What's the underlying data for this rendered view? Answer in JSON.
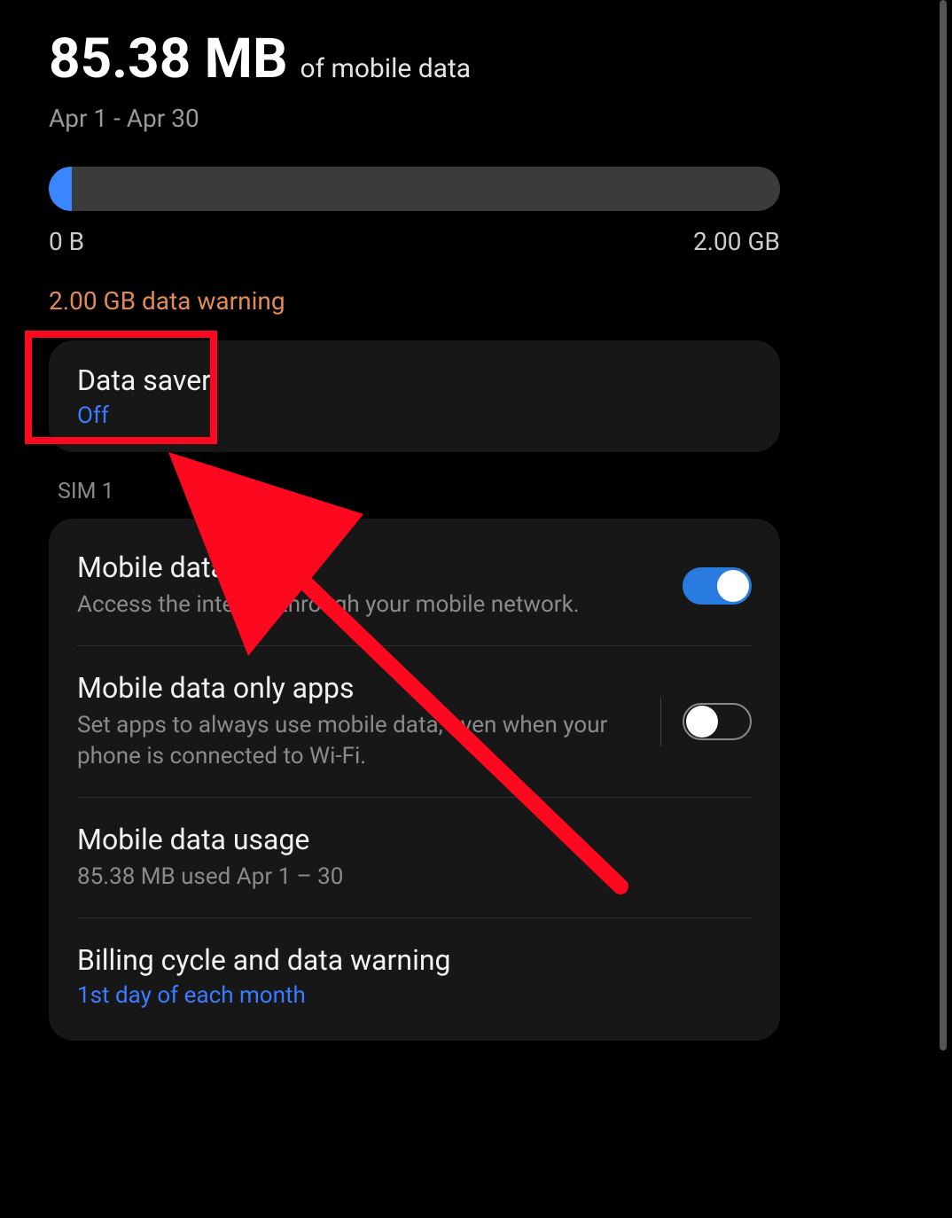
{
  "usage": {
    "amount": "85.38 MB",
    "of_label": "of mobile data",
    "period": "Apr 1 - Apr 30",
    "progress_min": "0 B",
    "progress_max": "2.00 GB"
  },
  "warning_text": "2.00 GB data warning",
  "data_saver": {
    "title": "Data saver",
    "status": "Off"
  },
  "section_label": "SIM 1",
  "rows": {
    "mobile_data": {
      "title": "Mobile data",
      "sub": "Access the internet through your mobile network."
    },
    "only_apps": {
      "title": "Mobile data only apps",
      "sub": "Set apps to always use mobile data, even when your phone is connected to Wi-Fi."
    },
    "usage": {
      "title": "Mobile data usage",
      "sub": "85.38 MB used Apr 1 – 30"
    },
    "billing": {
      "title": "Billing cycle and data warning",
      "sub": "1st day of each month"
    }
  }
}
